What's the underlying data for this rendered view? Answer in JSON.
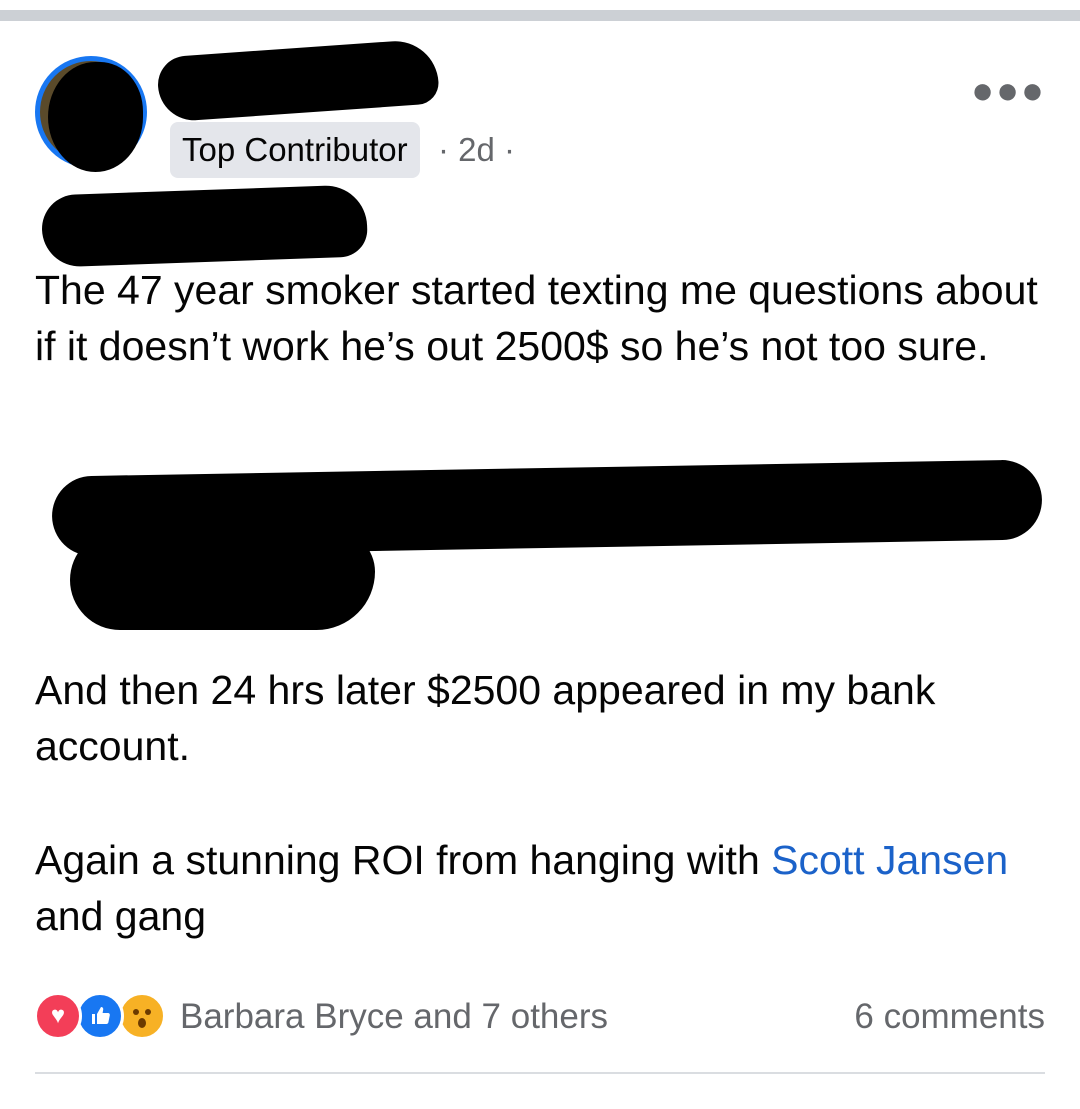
{
  "header": {
    "badge": "Top Contributor",
    "time": "· 2d ·",
    "more_icon": "more-horizontal-icon"
  },
  "post": {
    "para1": "The 47 year smoker started texting me questions about if it doesn’t work he’s out 2500$ so he’s not too sure.",
    "para3": "And then 24 hrs later $2500 appeared in my bank account.",
    "para4_before": "Again a stunning ROI from hanging with ",
    "mention": "Scott Jansen",
    "para4_after": " and gang"
  },
  "footer": {
    "reaction_icons": [
      "love-reaction-icon",
      "like-reaction-icon",
      "wow-reaction-icon"
    ],
    "reactors": "Barbara Bryce and 7 others",
    "comments": "6 comments"
  },
  "colors": {
    "link": "#1b62c9",
    "secondary_text": "#65676b",
    "badge_bg": "#e4e6eb",
    "avatar_ring": "#1877f2"
  }
}
